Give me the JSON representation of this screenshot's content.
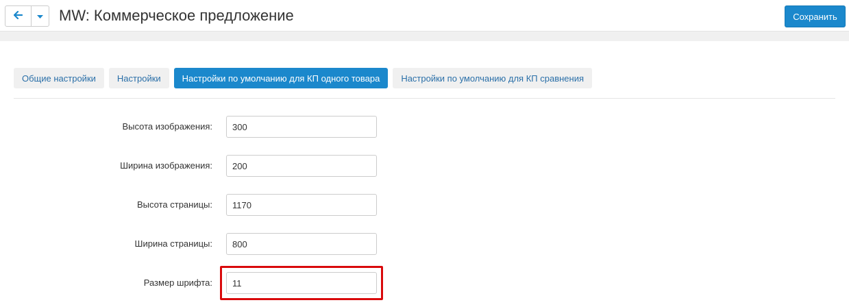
{
  "header": {
    "title": "MW: Коммерческое предложение",
    "save_label": "Сохранить",
    "back_icon": "arrow-left-icon",
    "dropdown_icon": "caret-down-icon"
  },
  "tabs": [
    {
      "label": "Общие настройки",
      "active": false
    },
    {
      "label": "Настройки",
      "active": false
    },
    {
      "label": "Настройки по умолчанию для КП одного товара",
      "active": true
    },
    {
      "label": "Настройки по умолчанию для КП сравнения",
      "active": false
    }
  ],
  "form": {
    "fields": [
      {
        "label": "Высота изображения:",
        "value": "300"
      },
      {
        "label": "Ширина изображения:",
        "value": "200"
      },
      {
        "label": "Высота страницы:",
        "value": "1170"
      },
      {
        "label": "Ширина страницы:",
        "value": "800"
      },
      {
        "label": "Размер шрифта:",
        "value": "11",
        "highlighted": true
      }
    ]
  },
  "colors": {
    "accent": "#1b88cc",
    "link": "#2a6fa8",
    "highlight": "#d9090b",
    "background": "#f0f0f0"
  }
}
